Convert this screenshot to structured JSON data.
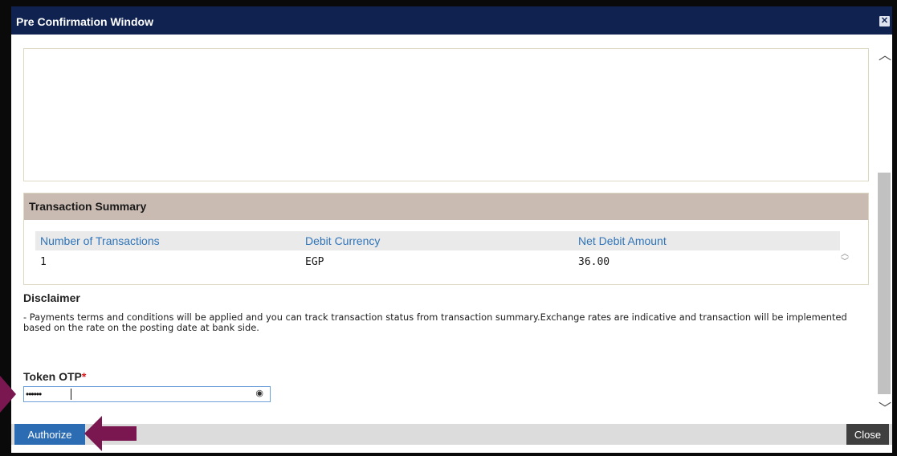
{
  "window": {
    "title": "Pre Confirmation Window",
    "close_glyph": "✕"
  },
  "summary": {
    "title": "Transaction Summary",
    "headers": [
      "Number of Transactions",
      "Debit Currency",
      "Net Debit Amount"
    ],
    "row": [
      "1",
      "EGP",
      "36.00"
    ]
  },
  "disclaimer": {
    "title": "Disclaimer",
    "text": "- Payments terms and conditions will be applied and you can track transaction status from transaction summary.Exchange rates are indicative and transaction will be implemented based on the rate on the posting date at bank side."
  },
  "otp": {
    "label": "Token OTP",
    "required_mark": "*",
    "masked_value": "••••••"
  },
  "footer": {
    "authorize_label": "Authorize",
    "close_label": "Close"
  },
  "colors": {
    "titlebar": "#0f2250",
    "summary_header": "#c9bbb1",
    "authorize": "#2b6cb3",
    "arrow": "#7a1650"
  }
}
